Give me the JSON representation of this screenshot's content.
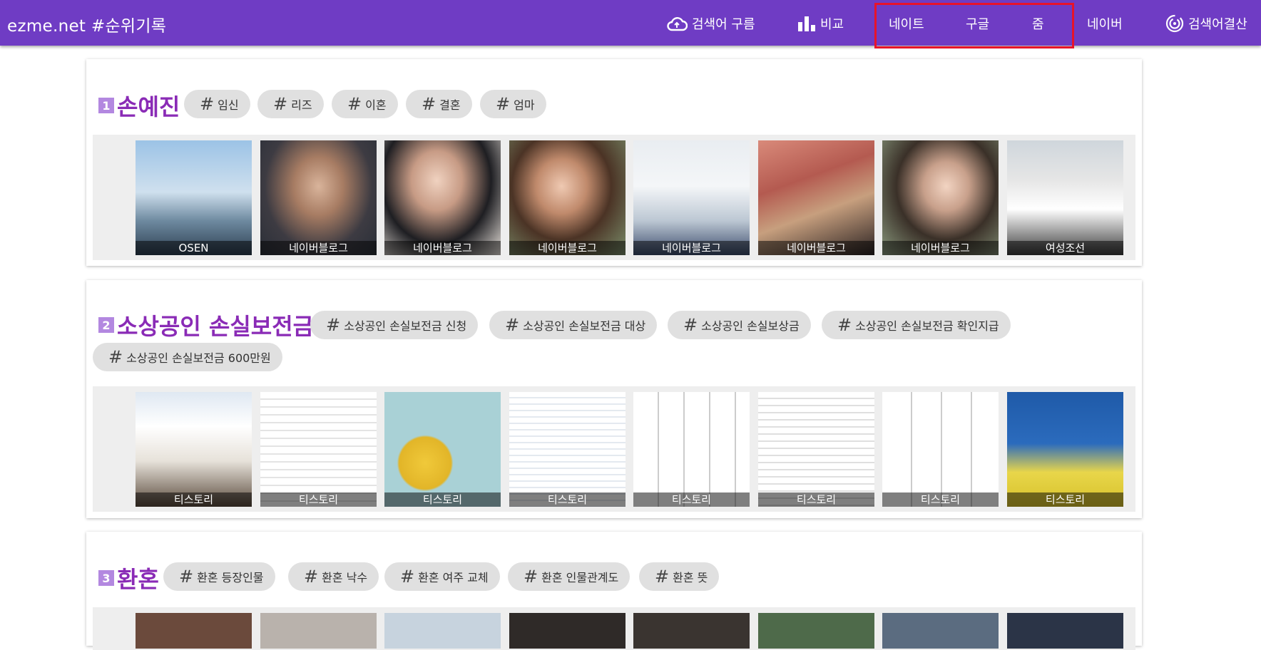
{
  "header": {
    "brand": "ezme.net #순위기록",
    "nav": [
      {
        "label": "검색어 구름",
        "icon": "cloud-icon"
      },
      {
        "label": "비교",
        "icon": "bar-chart-icon"
      },
      {
        "label": "네이트"
      },
      {
        "label": "구글"
      },
      {
        "label": "줌"
      },
      {
        "label": "네이버"
      },
      {
        "label": "검색어결산",
        "icon": "fingerprint-icon"
      }
    ]
  },
  "colors": {
    "topbar": "#6f3cc4",
    "keyword": "#8a2bb6",
    "rank_badge": "#b388e0",
    "highlight": "#e8132a"
  },
  "rankings": [
    {
      "rank": "1",
      "keyword": "손예진",
      "tags": [
        "임신",
        "리즈",
        "이혼",
        "결혼",
        "엄마"
      ],
      "images": [
        {
          "source": "OSEN"
        },
        {
          "source": "네이버블로그"
        },
        {
          "source": "네이버블로그"
        },
        {
          "source": "네이버블로그"
        },
        {
          "source": "네이버블로그"
        },
        {
          "source": "네이버블로그"
        },
        {
          "source": "네이버블로그"
        },
        {
          "source": "여성조선"
        }
      ]
    },
    {
      "rank": "2",
      "keyword": "소상공인 손실보전금",
      "tags": [
        "소상공인 손실보전금 신청",
        "소상공인 손실보전금 대상",
        "소상공인 손실보상금",
        "소상공인 손실보전금 확인지급",
        "소상공인 손실보전금 600만원"
      ],
      "images": [
        {
          "source": "티스토리"
        },
        {
          "source": "티스토리"
        },
        {
          "source": "티스토리"
        },
        {
          "source": "티스토리"
        },
        {
          "source": "티스토리"
        },
        {
          "source": "티스토리"
        },
        {
          "source": "티스토리"
        },
        {
          "source": "티스토리"
        }
      ]
    },
    {
      "rank": "3",
      "keyword": "환혼",
      "tags": [
        "환혼 등장인물",
        "환혼 낙수",
        "환혼 여주 교체",
        "환혼 인물관계도",
        "환혼 뜻"
      ]
    }
  ]
}
